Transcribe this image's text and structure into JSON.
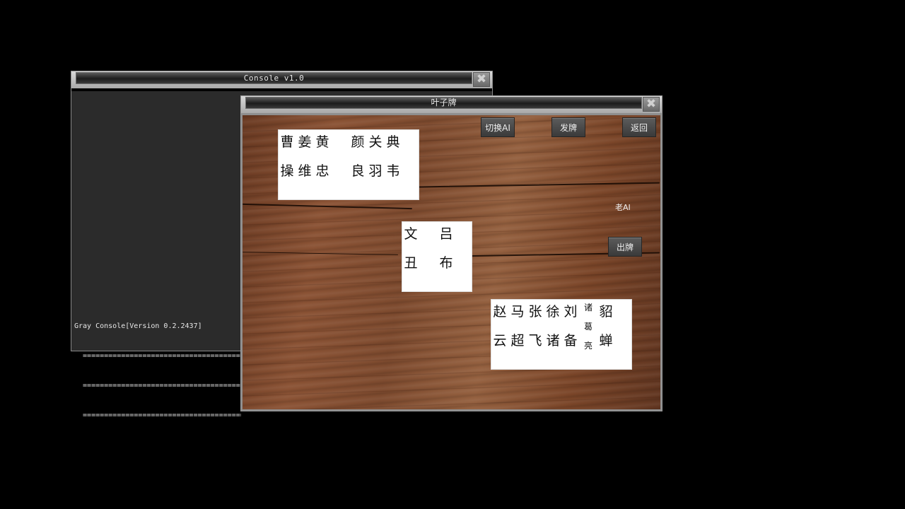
{
  "console": {
    "title": "Console v1.0",
    "close_glyph": "✖",
    "lines": [
      "Gray Console[Version 0.2.2437]",
      "  ========================================",
      "  ========================================",
      "  ========================================"
    ]
  },
  "game": {
    "title": "叶子牌",
    "close_glyph": "✖",
    "buttons": {
      "switch_ai": "切换AI",
      "deal": "发牌",
      "back": "返回",
      "play": "出牌"
    },
    "opponent_label": "老AI",
    "hands": {
      "top": [
        {
          "top": "曹",
          "bottom": "操"
        },
        {
          "top": "姜",
          "bottom": "维"
        },
        {
          "top": "黄",
          "bottom": "忠"
        },
        {
          "top": "",
          "bottom": ""
        },
        {
          "top": "颜",
          "bottom": "良"
        },
        {
          "top": "关",
          "bottom": "羽"
        },
        {
          "top": "典",
          "bottom": "韦"
        }
      ],
      "center": [
        {
          "top": "文",
          "bottom": "丑"
        },
        {
          "top": "",
          "bottom": ""
        },
        {
          "top": "吕",
          "bottom": "布"
        }
      ],
      "bottom": [
        {
          "top": "赵",
          "bottom": "云"
        },
        {
          "top": "马",
          "bottom": "超"
        },
        {
          "top": "张",
          "bottom": "飞"
        },
        {
          "top": "徐",
          "bottom": "诸"
        },
        {
          "top": "刘",
          "bottom": "备"
        },
        {
          "top": "诸",
          "middle": "葛",
          "bottom": "亮"
        },
        {
          "top": "貂",
          "bottom": "蝉"
        }
      ]
    }
  }
}
